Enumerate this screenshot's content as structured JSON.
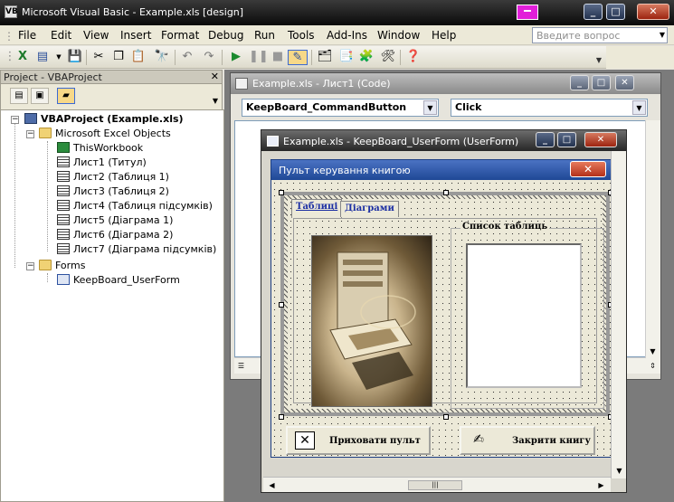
{
  "window": {
    "title": "Microsoft Visual Basic - Example.xls [design]",
    "app_icon": "vba-icon",
    "controls": [
      "minimize",
      "maximize",
      "close"
    ]
  },
  "menubar": {
    "items": [
      "File",
      "Edit",
      "View",
      "Insert",
      "Format",
      "Debug",
      "Run",
      "Tools",
      "Add-Ins",
      "Window",
      "Help"
    ],
    "help_placeholder": "Введите вопрос"
  },
  "toolbar": {
    "icons": [
      "excel-icon",
      "insert-userform-icon",
      "save-icon",
      "cut-icon",
      "copy-icon",
      "paste-icon",
      "find-icon",
      "undo-icon",
      "redo-icon",
      "run-icon",
      "break-icon",
      "reset-icon",
      "design-mode-icon",
      "project-explorer-icon",
      "properties-icon",
      "object-browser-icon",
      "toolbox-icon",
      "help-icon"
    ]
  },
  "project": {
    "header": "Project - VBAProject",
    "root": "VBAProject (Example.xls)",
    "folders": {
      "excel_objects": "Microsoft Excel Objects",
      "forms": "Forms"
    },
    "excel_items": [
      "ThisWorkbook",
      "Лист1 (Титул)",
      "Лист2 (Таблиця 1)",
      "Лист3 (Таблиця 2)",
      "Лист4 (Таблиця підсумків)",
      "Лист5 (Діаграма 1)",
      "Лист6 (Діаграма 2)",
      "Лист7 (Діаграма підсумків)"
    ],
    "form_items": [
      "KeepBoard_UserForm"
    ]
  },
  "code_window": {
    "title": "Example.xls - Лист1 (Code)",
    "object_combo": "KeepBoard_CommandButton",
    "procedure_combo": "Click"
  },
  "form_window": {
    "title": "Example.xls - KeepBoard_UserForm (UserForm)"
  },
  "userform": {
    "caption": "Пульт керування книгою",
    "tabs": [
      "Таблиці",
      "Діаграми"
    ],
    "list_caption": "Список таблиць",
    "button_hide": "Приховати пульт",
    "button_close": "Закрити книгу"
  }
}
